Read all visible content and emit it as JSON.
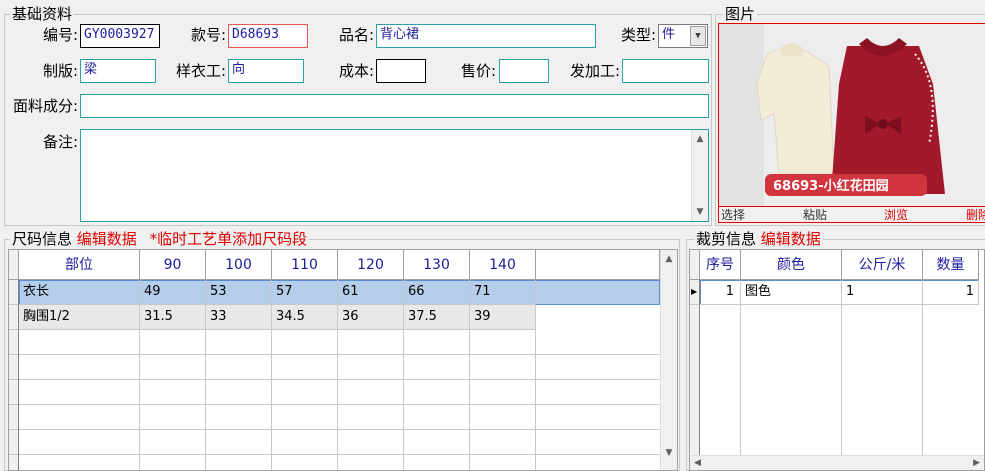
{
  "basic": {
    "legend": "基础资料",
    "code_label": "编号:",
    "code_value": "GY0003927",
    "style_label": "款号:",
    "style_value": "D68693",
    "name_label": "品名:",
    "name_value": "背心裙",
    "type_label": "类型:",
    "type_value": "件",
    "maker_label": "制版:",
    "maker_value": "梁",
    "sampler_label": "样衣工:",
    "sampler_value": "向",
    "cost_label": "成本:",
    "cost_value": "",
    "price_label": "售价:",
    "price_value": "",
    "processor_label": "发加工:",
    "processor_value": "",
    "fabric_label": "面料成分:",
    "fabric_value": "",
    "note_label": "备注:",
    "note_value": ""
  },
  "photo": {
    "legend": "图片",
    "caption": "68693-小红花田园",
    "buttons": [
      "选择",
      "粘贴",
      "浏览",
      "删除"
    ],
    "colors": {
      "bg": "#eeeeee",
      "dress": "#a3192c",
      "sweater": "#f3ecd9",
      "caption_bg": "#d2343e"
    }
  },
  "size": {
    "legend": "尺码信息",
    "edit": "编辑数据",
    "tip": "*临时工艺单添加尺码段",
    "columns": [
      "部位",
      "90",
      "100",
      "110",
      "120",
      "130",
      "140"
    ],
    "rows": [
      [
        "衣长",
        "49",
        "53",
        "57",
        "61",
        "66",
        "71"
      ],
      [
        "胸围1/2",
        "31.5",
        "33",
        "34.5",
        "36",
        "37.5",
        "39"
      ]
    ]
  },
  "cut": {
    "legend": "裁剪信息",
    "edit": "编辑数据",
    "columns": [
      "序号",
      "颜色",
      "公斤/米",
      "数量"
    ],
    "rows": [
      [
        "1",
        "图色",
        "1",
        "1"
      ]
    ]
  }
}
